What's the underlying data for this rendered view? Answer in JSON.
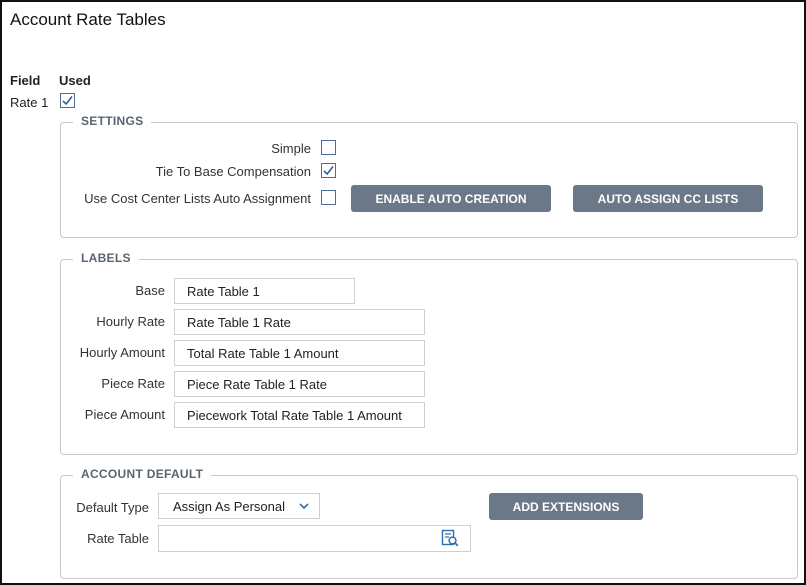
{
  "page": {
    "title": "Account Rate Tables"
  },
  "columns": {
    "field": "Field",
    "used": "Used"
  },
  "row": {
    "label": "Rate 1",
    "used_checked": true
  },
  "settings": {
    "legend": "SETTINGS",
    "simple": {
      "label": "Simple",
      "checked": false
    },
    "tie_to_base": {
      "label": "Tie To Base Compensation",
      "checked": true
    },
    "cost_center": {
      "label": "Use Cost Center Lists Auto Assignment",
      "checked": false
    },
    "enable_auto_creation": "ENABLE AUTO CREATION",
    "auto_assign_cc": "AUTO ASSIGN CC LISTS"
  },
  "labels": {
    "legend": "LABELS",
    "base": {
      "label": "Base",
      "value": "Rate Table 1"
    },
    "hourly_rate": {
      "label": "Hourly Rate",
      "value": "Rate Table 1 Rate"
    },
    "hourly_amount": {
      "label": "Hourly Amount",
      "value": "Total Rate Table 1 Amount"
    },
    "piece_rate": {
      "label": "Piece Rate",
      "value": "Piece Rate Table 1 Rate"
    },
    "piece_amount": {
      "label": "Piece Amount",
      "value": "Piecework Total Rate Table 1 Amount"
    }
  },
  "account_default": {
    "legend": "ACCOUNT DEFAULT",
    "default_type": {
      "label": "Default Type",
      "value": "Assign As Personal"
    },
    "add_extensions": "ADD EXTENSIONS",
    "rate_table": {
      "label": "Rate Table",
      "value": ""
    }
  },
  "colors": {
    "button_bg": "#6b7888",
    "checkbox_border": "#4a6e9a",
    "legend_text": "#5a6470"
  },
  "icons": {
    "check": "check-icon",
    "chevron": "chevron-down-icon",
    "lookup": "lookup-icon"
  }
}
